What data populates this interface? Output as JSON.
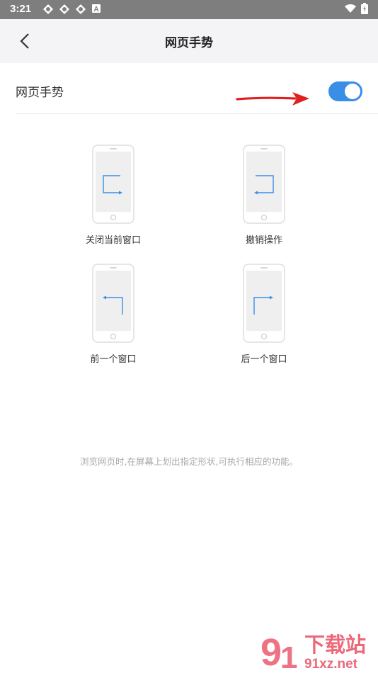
{
  "status_bar": {
    "time": "3:21",
    "icons": [
      "notification-icon",
      "notification-icon",
      "notification-icon",
      "a-badge-icon",
      "wifi-icon",
      "battery-icon"
    ],
    "badge_letter": "A"
  },
  "nav": {
    "title": "网页手势",
    "back_icon": "chevron-left-icon"
  },
  "setting": {
    "label": "网页手势",
    "toggle_on": true,
    "accent_color": "#3a8ee6"
  },
  "gestures": [
    {
      "label": "关闭当前窗口",
      "icon": "gesture-close-window-icon"
    },
    {
      "label": "撤销操作",
      "icon": "gesture-undo-icon"
    },
    {
      "label": "前一个窗口",
      "icon": "gesture-previous-window-icon"
    },
    {
      "label": "后一个窗口",
      "icon": "gesture-next-window-icon"
    }
  ],
  "hint": "浏览网页时,在屏幕上划出指定形状,可执行相应的功能。",
  "watermark": {
    "brand": "下载站",
    "domain": "91xz.net"
  }
}
